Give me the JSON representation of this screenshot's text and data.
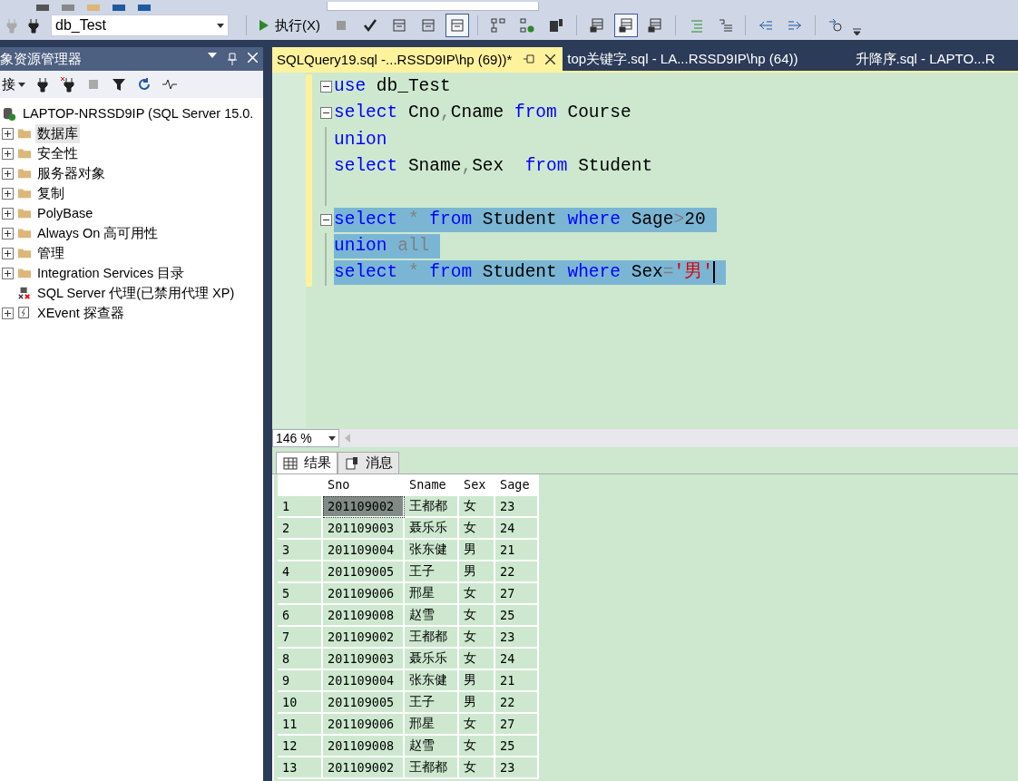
{
  "toolbar": {
    "database": "db_Test",
    "execute": "执行(X)",
    "toggles_a": [
      {
        "selected": false
      },
      {
        "selected": false
      },
      {
        "selected": true
      }
    ],
    "toggles_b": [
      {
        "selected": false
      },
      {
        "selected": true
      },
      {
        "selected": false
      }
    ]
  },
  "explorer": {
    "title": "象资源管理器",
    "connect": "接",
    "server": "LAPTOP-NRSSD9IP (SQL Server 15.0.",
    "nodes": [
      {
        "kind": "folder",
        "label": "数据库",
        "selected": true
      },
      {
        "kind": "folder",
        "label": "安全性",
        "selected": false
      },
      {
        "kind": "folder",
        "label": "服务器对象",
        "selected": false
      },
      {
        "kind": "folder",
        "label": "复制",
        "selected": false
      },
      {
        "kind": "folder",
        "label": "PolyBase",
        "selected": false
      },
      {
        "kind": "folder",
        "label": "Always On 高可用性",
        "selected": false
      },
      {
        "kind": "folder",
        "label": "管理",
        "selected": false
      },
      {
        "kind": "folder",
        "label": "Integration Services 目录",
        "selected": false
      },
      {
        "kind": "agent",
        "label": "SQL Server 代理(已禁用代理 XP)",
        "selected": false
      },
      {
        "kind": "xevent",
        "label": "XEvent 探查器",
        "selected": false
      }
    ]
  },
  "tabs": [
    {
      "label": "SQLQuery19.sql -...RSSD9IP\\hp (69))*",
      "selected": true
    },
    {
      "label": "top关键字.sql - LA...RSSD9IP\\hp (64))",
      "selected": false
    },
    {
      "label": "升降序.sql - LAPTO...R",
      "selected": false
    }
  ],
  "code": [
    {
      "fold_box": true,
      "selected": false,
      "tokens": [
        {
          "kind": "keyword",
          "text": "use"
        },
        {
          "kind": "plain",
          "text": " db_Test"
        }
      ]
    },
    {
      "fold_box": true,
      "selected": false,
      "tokens": [
        {
          "kind": "keyword",
          "text": "select"
        },
        {
          "kind": "plain",
          "text": " Cno"
        },
        {
          "kind": "op",
          "text": ","
        },
        {
          "kind": "plain",
          "text": "Cname "
        },
        {
          "kind": "keyword",
          "text": "from"
        },
        {
          "kind": "plain",
          "text": " Course"
        }
      ]
    },
    {
      "fold_box": false,
      "selected": false,
      "tokens": [
        {
          "kind": "keyword",
          "text": "union"
        }
      ]
    },
    {
      "fold_box": false,
      "selected": false,
      "tokens": [
        {
          "kind": "keyword",
          "text": "select"
        },
        {
          "kind": "plain",
          "text": " Sname"
        },
        {
          "kind": "op",
          "text": ","
        },
        {
          "kind": "plain",
          "text": "Sex  "
        },
        {
          "kind": "keyword",
          "text": "from"
        },
        {
          "kind": "plain",
          "text": " Student"
        }
      ]
    },
    {
      "fold_box": false,
      "selected": false
    },
    {
      "fold_box": true,
      "selected": true,
      "tokens": [
        {
          "kind": "keyword",
          "text": "select"
        },
        {
          "kind": "op",
          "text": " *"
        },
        {
          "kind": "keyword",
          "text": " from"
        },
        {
          "kind": "plain",
          "text": " Student"
        },
        {
          "kind": "keyword",
          "text": " where"
        },
        {
          "kind": "plain",
          "text": " Sage"
        },
        {
          "kind": "op",
          "text": ">"
        },
        {
          "kind": "plain",
          "text": "20"
        }
      ]
    },
    {
      "fold_box": false,
      "selected": true,
      "tokens": [
        {
          "kind": "keyword",
          "text": "union"
        },
        {
          "kind": "op",
          "text": " all"
        }
      ]
    },
    {
      "fold_box": false,
      "selected": true,
      "tokens": [
        {
          "kind": "keyword",
          "text": "select"
        },
        {
          "kind": "op",
          "text": " *"
        },
        {
          "kind": "keyword",
          "text": " from"
        },
        {
          "kind": "plain",
          "text": " Student"
        },
        {
          "kind": "keyword",
          "text": " where"
        },
        {
          "kind": "plain",
          "text": " Sex"
        },
        {
          "kind": "op",
          "text": "="
        },
        {
          "kind": "string",
          "text": "'男'"
        }
      ]
    }
  ],
  "zoom": "146 %",
  "result_tabs": [
    {
      "kind": "grid",
      "label": "结果",
      "selected": true
    },
    {
      "kind": "messages",
      "label": "消息",
      "selected": false
    }
  ],
  "columns": [
    "Sno",
    "Sname",
    "Sex",
    "Sage"
  ],
  "rows": [
    {
      "n": "1",
      "cells": [
        "201109002",
        "王都都",
        "女",
        "23"
      ],
      "selected": true
    },
    {
      "n": "2",
      "cells": [
        "201109003",
        "聂乐乐",
        "女",
        "24"
      ],
      "selected": false
    },
    {
      "n": "3",
      "cells": [
        "201109004",
        "张东健",
        "男",
        "21"
      ],
      "selected": false
    },
    {
      "n": "4",
      "cells": [
        "201109005",
        "王子",
        "男",
        "22"
      ],
      "selected": false
    },
    {
      "n": "5",
      "cells": [
        "201109006",
        "邢星",
        "女",
        "27"
      ],
      "selected": false
    },
    {
      "n": "6",
      "cells": [
        "201109008",
        "赵雪",
        "女",
        "25"
      ],
      "selected": false
    },
    {
      "n": "7",
      "cells": [
        "201109002",
        "王都都",
        "女",
        "23"
      ],
      "selected": false
    },
    {
      "n": "8",
      "cells": [
        "201109003",
        "聂乐乐",
        "女",
        "24"
      ],
      "selected": false
    },
    {
      "n": "9",
      "cells": [
        "201109004",
        "张东健",
        "男",
        "21"
      ],
      "selected": false
    },
    {
      "n": "10",
      "cells": [
        "201109005",
        "王子",
        "男",
        "22"
      ],
      "selected": false
    },
    {
      "n": "11",
      "cells": [
        "201109006",
        "邢星",
        "女",
        "27"
      ],
      "selected": false
    },
    {
      "n": "12",
      "cells": [
        "201109008",
        "赵雪",
        "女",
        "25"
      ],
      "selected": false
    },
    {
      "n": "13",
      "cells": [
        "201109002",
        "王都都",
        "女",
        "23"
      ],
      "selected": false
    }
  ]
}
